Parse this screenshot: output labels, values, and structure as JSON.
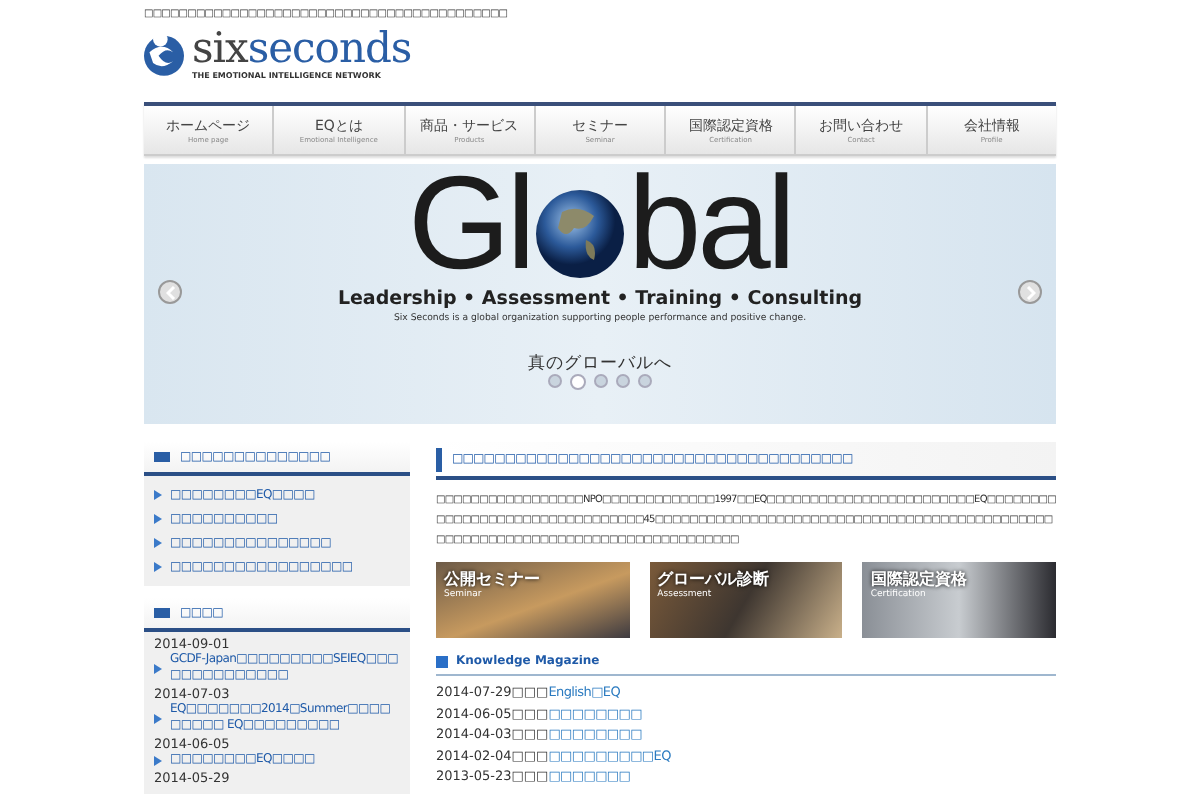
{
  "header": {
    "tagline": "□□□□□□□□□□□□□□□□□□□□□□□□□□□□□□□□□□□□□□□□□□",
    "logo_six": "six",
    "logo_seconds": "seconds",
    "logo_subtitle": "THE EMOTIONAL INTELLIGENCE NETWORK"
  },
  "nav": [
    {
      "label": "ホームページ",
      "sub": "Home page"
    },
    {
      "label": "EQとは",
      "sub": "Emotional Intelligence"
    },
    {
      "label": "商品・サービス",
      "sub": "Products"
    },
    {
      "label": "セミナー",
      "sub": "Seminar"
    },
    {
      "label": "国際認定資格",
      "sub": "Certification"
    },
    {
      "label": "お問い合わせ",
      "sub": "Contact"
    },
    {
      "label": "会社情報",
      "sub": "Profile"
    }
  ],
  "hero": {
    "title_start": "Gl",
    "title_end": "bal",
    "headline": "Leadership • Assessment • Training • Consulting",
    "sentence": "Six Seconds is a global organization supporting people performance and positive change.",
    "caption": "真のグローバルへ",
    "dots": [
      {
        "selected": false
      },
      {
        "selected": true
      },
      {
        "selected": false
      },
      {
        "selected": false
      },
      {
        "selected": false
      }
    ]
  },
  "sidebar": {
    "links_title": "□□□□□□□□□□□□□□",
    "links": [
      "□□□□□□□□EQ□□□□",
      "□□□□□□□□□□",
      "□□□□□□□□□□□□□□□",
      "□□□□□□□□□□□□□□□□□"
    ],
    "news_title": "□□□□",
    "news": [
      {
        "date": "2014-09-01",
        "text": "GCDF-Japan□□□□□□□□□SEIEQ□□□□□□□□□□□□□□"
      },
      {
        "date": "2014-07-03",
        "text": "EQ□□□□□□□2014□Summer□□□□□□□□□ EQ□□□□□□□□□"
      },
      {
        "date": "2014-06-05",
        "text": "□□□□□□□□EQ□□□□"
      },
      {
        "date": "2014-05-29"
      }
    ]
  },
  "main": {
    "heading": "□□□□□□□□□□□□□□□□□□□□□□□□□□□□□□□□□□□□□□",
    "paragraph": "□□□□□□□□□□□□□□□□□NPO□□□□□□□□□□□□□1997□□EQ□□□□□□□□□□□□□□□□□□□□□□□□EQ□□□□□□□□□□□□□□□□□□□□□□□□□□□□□□□□45□□□□□□□□□□□□□□□□□□□□□□□□□□□□□□□□□□□□□□□□□□□□□□□□□□□□□□□□□□□□□□□□□□□□□□□□□□□□□□□□□",
    "cards": [
      {
        "title": "公開セミナー",
        "subtitle": "Seminar"
      },
      {
        "title": "グローバル診断",
        "subtitle": "Assessment"
      },
      {
        "title": "国際認定資格",
        "subtitle": "Certification"
      }
    ],
    "magazine_title": "Knowledge Magazine",
    "magazine": [
      {
        "date": "2014-07-29",
        "prefix": "□□□",
        "title": "English□EQ"
      },
      {
        "date": "2014-06-05",
        "prefix": "□□□",
        "title": "□□□□□□□□"
      },
      {
        "date": "2014-04-03",
        "prefix": "□□□",
        "title": "□□□□□□□□"
      },
      {
        "date": "2014-02-04",
        "prefix": "□□□",
        "title": "□□□□□□□□□EQ"
      },
      {
        "date": "2013-05-23",
        "prefix": "□□□",
        "title": "□□□□□□□"
      }
    ]
  }
}
